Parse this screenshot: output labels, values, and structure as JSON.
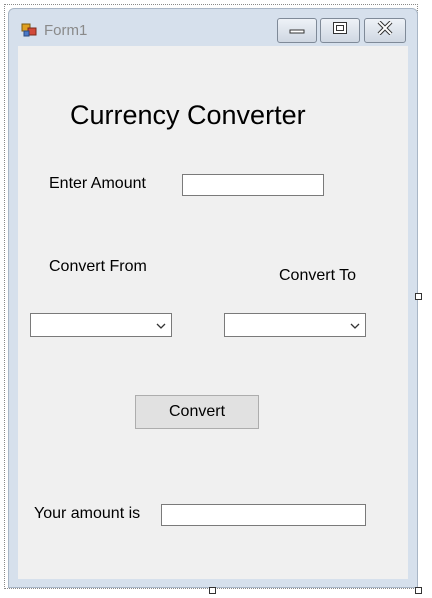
{
  "window": {
    "title": "Form1",
    "icon": "form-app-icon",
    "controls": [
      "minimize-icon",
      "maximize-icon",
      "close-icon"
    ]
  },
  "form": {
    "heading": "Currency Converter",
    "amount_label": "Enter Amount",
    "amount_value": "",
    "from_label": "Convert From",
    "from_value": "",
    "to_label": "Convert To",
    "to_value": "",
    "convert_button": "Convert",
    "result_label": "Your amount is",
    "result_value": ""
  },
  "colors": {
    "client_bg": "#f0f0f0",
    "frame": "#d6e0ec",
    "button_bg": "#e1e1e1"
  }
}
